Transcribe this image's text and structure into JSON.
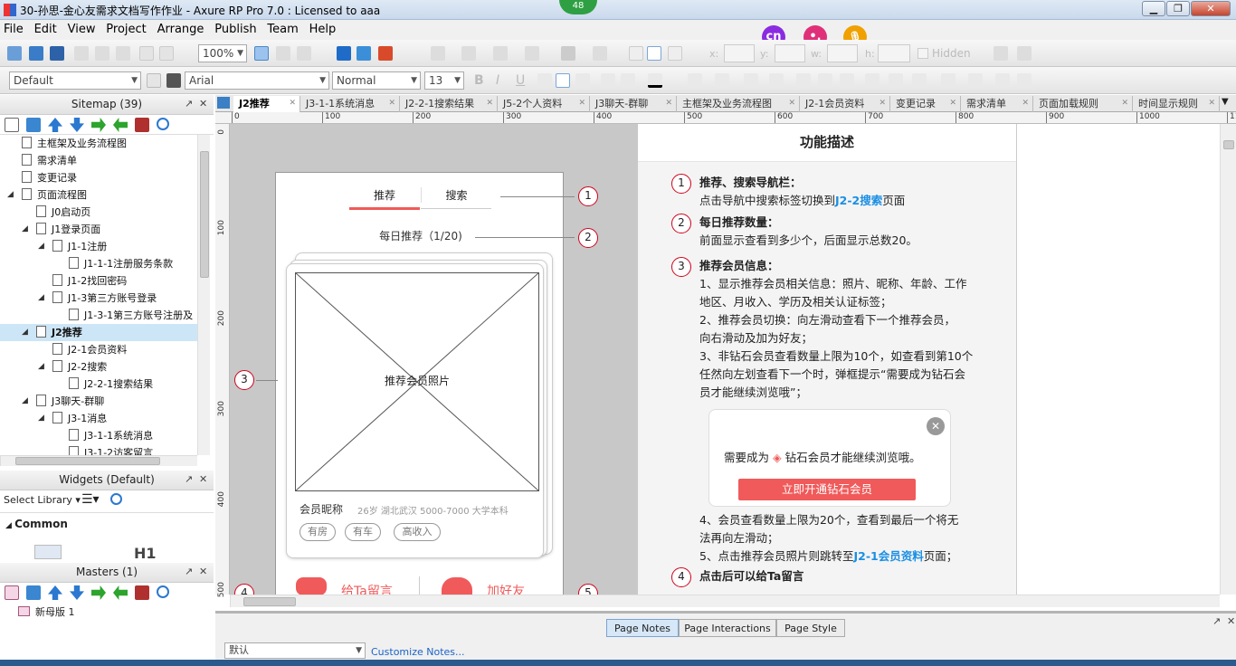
{
  "window": {
    "title": "30-孙思-金心友需求文档写作作业 - Axure RP Pro 7.0 : Licensed to aaa",
    "badge": "48",
    "min": "▁",
    "max": "❐",
    "close": "✕"
  },
  "menu": {
    "file": "File",
    "edit": "Edit",
    "view": "View",
    "project": "Project",
    "arrange": "Arrange",
    "publish": "Publish",
    "team": "Team",
    "help": "Help"
  },
  "float_buttons": {
    "cn": "cn",
    "dot": "•,",
    "mic": "🎙"
  },
  "toolbar": {
    "zoom": "100%",
    "x_label": "x:",
    "y_label": "y:",
    "w_label": "w:",
    "h_label": "h:",
    "hidden_label": "Hidden",
    "style_select": "Default",
    "font_select": "Arial",
    "weight_select": "Normal",
    "size_select": "13",
    "bold": "B",
    "italic": "I",
    "underline": "U"
  },
  "sitemap": {
    "title": "Sitemap (39)",
    "items": [
      {
        "label": "主框架及业务流程图",
        "level": 0
      },
      {
        "label": "需求清单",
        "level": 0
      },
      {
        "label": "变更记录",
        "level": 0
      },
      {
        "label": "页面流程图",
        "level": 0
      },
      {
        "label": "J0启动页",
        "level": 1
      },
      {
        "label": "J1登录页面",
        "level": 1
      },
      {
        "label": "J1-1注册",
        "level": 2
      },
      {
        "label": "J1-1-1注册服务条款",
        "level": 3
      },
      {
        "label": "J1-2找回密码",
        "level": 2
      },
      {
        "label": "J1-3第三方账号登录",
        "level": 2
      },
      {
        "label": "J1-3-1第三方账号注册及",
        "level": 3
      },
      {
        "label": "J2推荐",
        "level": 1
      },
      {
        "label": "J2-1会员资料",
        "level": 2
      },
      {
        "label": "J2-2搜索",
        "level": 2
      },
      {
        "label": "J2-2-1搜索结果",
        "level": 3
      },
      {
        "label": "J3聊天-群聊",
        "level": 1
      },
      {
        "label": "J3-1消息",
        "level": 2
      },
      {
        "label": "J3-1-1系统消息",
        "level": 3
      },
      {
        "label": "J3-1-2访客留言",
        "level": 3
      }
    ]
  },
  "widgets": {
    "title": "Widgets (Default)",
    "select_library": "Select Library",
    "group": "Common",
    "h1": "H1"
  },
  "masters": {
    "title": "Masters (1)",
    "items": [
      "新母版 1"
    ]
  },
  "tabs": [
    "J2推荐",
    "J3-1-1系统消息",
    "J2-2-1搜索结果",
    "J5-2个人资料",
    "J3聊天-群聊",
    "主框架及业务流程图",
    "J2-1会员资料",
    "变更记录",
    "需求清单",
    "页面加载规则",
    "时间显示规则"
  ],
  "ruler": {
    "h": [
      "0",
      "100",
      "200",
      "300",
      "400",
      "500",
      "600",
      "700",
      "800",
      "900",
      "1000",
      "11"
    ],
    "v": [
      "0",
      "100",
      "200",
      "300",
      "400",
      "500"
    ]
  },
  "mock": {
    "tab_recommend": "推荐",
    "tab_search": "搜索",
    "daily": "每日推荐（1/20)",
    "photo": "推荐会员照片",
    "nickname": "会员昵称",
    "info": "26岁 湖北武汉 5000-7000 大学本科",
    "tags": [
      "有房",
      "有车",
      "高收入"
    ],
    "msg_btn": "给Ta留言",
    "add_btn": "加好友",
    "markers": [
      "1",
      "2",
      "3",
      "4",
      "5"
    ]
  },
  "notes": {
    "heading": "功能描述",
    "n1_title": "推荐、搜索导航栏：",
    "n1_a": "点击导航中搜索标签切换到",
    "n1_link": "J2-2搜索",
    "n1_b": "页面",
    "n2_title": "每日推荐数量：",
    "n2_body": "前面显示查看到多少个，后面显示总数20。",
    "n3_title": "推荐会员信息：",
    "n3_l1": "1、显示推荐会员相关信息：照片、昵称、年龄、工作",
    "n3_l2": "地区、月收入、学历及相关认证标签；",
    "n3_l3": "2、推荐会员切换：向左滑动查看下一个推荐会员，",
    "n3_l4": "向右滑动及加为好友；",
    "n3_l5": "3、非钻石会员查看数量上限为10个，如查看到第10个",
    "n3_l6": "任然向左划查看下一个时，弹框提示“需要成为钻石会",
    "n3_l7": "员才能继续浏览哦”；",
    "popup_a": "需要成为",
    "popup_b": "钻石会员才能继续浏览哦。",
    "popup_btn": "立即开通钻石会员",
    "n3_l8": "4、会员查看数量上限为20个，查看到最后一个将无",
    "n3_l9": "法再向左滑动；",
    "n3_l10a": "5、点击推荐会员照片则跳转至",
    "n3_link": "J2-1会员资料",
    "n3_l10b": "页面；",
    "n4_title": "点击后可以给Ta留言",
    "nums": [
      "1",
      "2",
      "3",
      "4"
    ]
  },
  "bottom": {
    "page_notes": "Page Notes",
    "page_interactions": "Page Interactions",
    "page_style": "Page Style",
    "default_select": "默认",
    "customize": "Customize Notes..."
  },
  "colors": {
    "accent": "#f05a5a",
    "link": "#1a8fe3",
    "marker": "#d0021b"
  }
}
